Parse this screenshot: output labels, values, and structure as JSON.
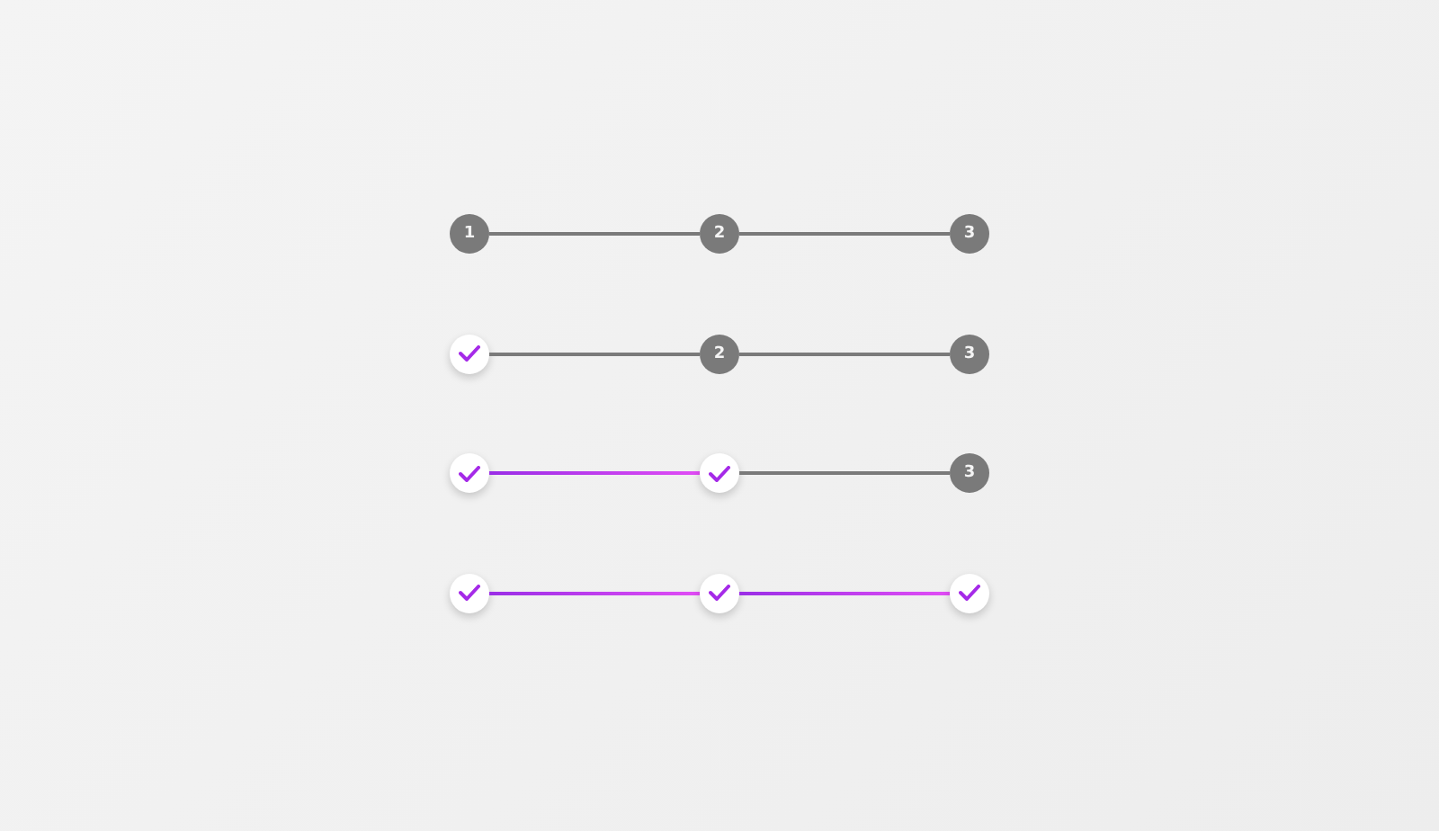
{
  "steppers": [
    {
      "steps": [
        {
          "completed": false,
          "label": "1"
        },
        {
          "completed": false,
          "label": "2"
        },
        {
          "completed": false,
          "label": "3"
        }
      ]
    },
    {
      "steps": [
        {
          "completed": true
        },
        {
          "completed": false,
          "label": "2"
        },
        {
          "completed": false,
          "label": "3"
        }
      ]
    },
    {
      "steps": [
        {
          "completed": true
        },
        {
          "completed": true
        },
        {
          "completed": false,
          "label": "3"
        }
      ]
    },
    {
      "steps": [
        {
          "completed": true
        },
        {
          "completed": true
        },
        {
          "completed": true
        }
      ]
    }
  ]
}
